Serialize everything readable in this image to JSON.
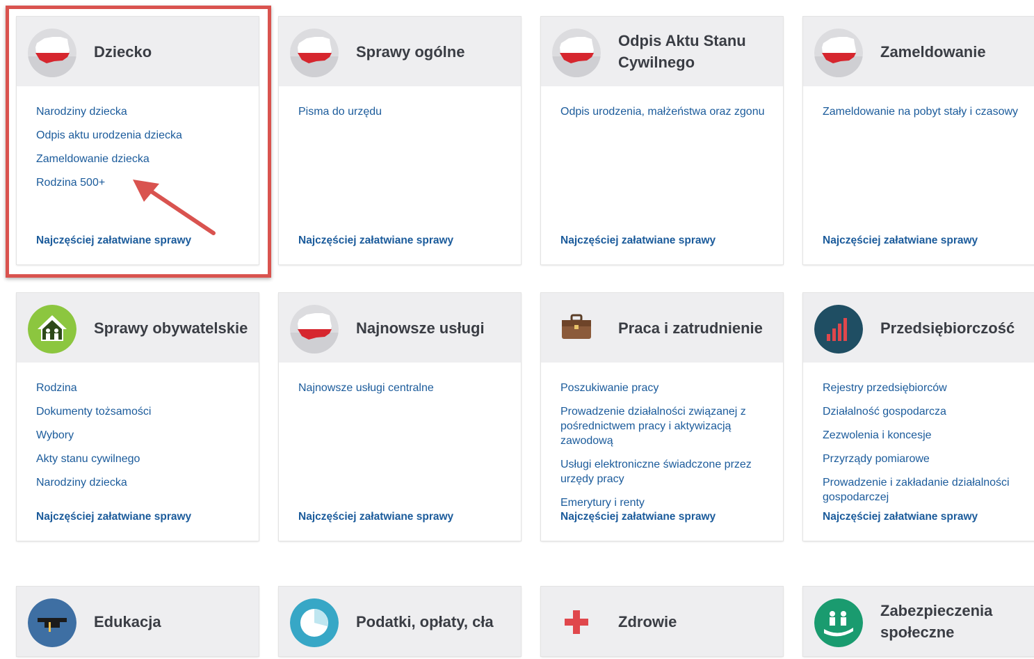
{
  "footer_link_label": "Najczęściej załatwiane sprawy",
  "colors": {
    "link": "#1b5b9b",
    "title": "#3a3d44",
    "header_bg": "#eeeef0",
    "highlight": "#d9534f"
  },
  "cards": [
    {
      "title": "Dziecko",
      "icon": "poland-map-icon",
      "links": [
        "Narodziny dziecka",
        "Odpis aktu urodzenia dziecka",
        "Zameldowanie dziecka",
        "Rodzina 500+"
      ]
    },
    {
      "title": "Sprawy ogólne",
      "icon": "poland-map-icon",
      "links": [
        "Pisma do urzędu"
      ]
    },
    {
      "title": "Odpis Aktu Stanu Cywilnego",
      "icon": "poland-map-icon",
      "links": [
        "Odpis urodzenia, małżeństwa oraz zgonu"
      ]
    },
    {
      "title": "Zameldowanie",
      "icon": "poland-map-icon",
      "links": [
        "Zameldowanie na pobyt stały i czasowy"
      ]
    },
    {
      "title": "Sprawy obywatelskie",
      "icon": "family-house-icon",
      "links": [
        "Rodzina",
        "Dokumenty tożsamości",
        "Wybory",
        "Akty stanu cywilnego",
        "Narodziny dziecka"
      ]
    },
    {
      "title": "Najnowsze usługi",
      "icon": "poland-map-icon",
      "links": [
        "Najnowsze usługi centralne"
      ]
    },
    {
      "title": "Praca i zatrudnienie",
      "icon": "briefcase-icon",
      "links": [
        "Poszukiwanie pracy",
        "Prowadzenie działalności związanej z pośrednictwem pracy i aktywizacją zawodową",
        "Usługi elektroniczne świadczone przez urzędy pracy",
        "Emerytury i renty"
      ]
    },
    {
      "title": "Przedsiębiorczość",
      "icon": "bar-chart-icon",
      "links": [
        "Rejestry przedsiębiorców",
        "Działalność gospodarcza",
        "Zezwolenia i koncesje",
        "Przyrządy pomiarowe",
        "Prowadzenie i zakładanie działalności gospodarczej"
      ]
    },
    {
      "title": "Edukacja",
      "icon": "graduation-cap-icon",
      "links": []
    },
    {
      "title": "Podatki, opłaty, cła",
      "icon": "pie-chart-icon",
      "links": []
    },
    {
      "title": "Zdrowie",
      "icon": "medical-cross-icon",
      "links": []
    },
    {
      "title": "Zabezpieczenia społeczne",
      "icon": "social-care-icon",
      "links": []
    }
  ]
}
